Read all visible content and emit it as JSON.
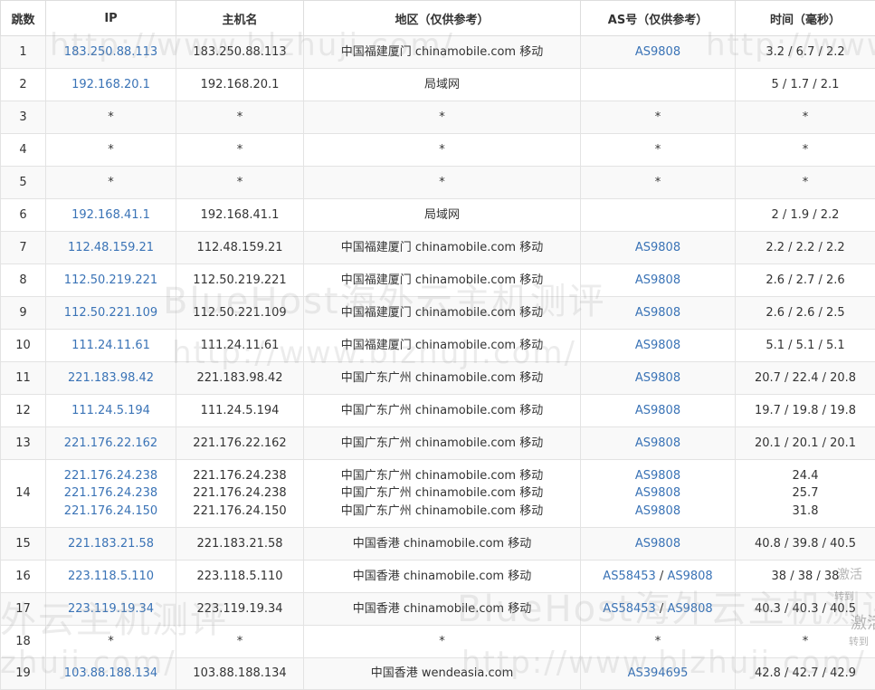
{
  "headers": {
    "hop": "跳数",
    "ip": "IP",
    "host": "主机名",
    "region": "地区（仅供参考）",
    "as": "AS号（仅供参考）",
    "time": "时间（毫秒）"
  },
  "rows": [
    {
      "hop": "1",
      "ips": [
        "183.250.88.113"
      ],
      "hosts": [
        "183.250.88.113"
      ],
      "regions": [
        "中国福建厦门 chinamobile.com 移动"
      ],
      "as": [
        [
          "AS9808"
        ]
      ],
      "times": [
        "3.2 / 6.7 / 2.2"
      ]
    },
    {
      "hop": "2",
      "ips": [
        "192.168.20.1"
      ],
      "hosts": [
        "192.168.20.1"
      ],
      "regions": [
        "局域网"
      ],
      "as": [],
      "times": [
        "5 / 1.7 / 2.1"
      ]
    },
    {
      "hop": "3",
      "ips": [
        "*"
      ],
      "hosts": [
        "*"
      ],
      "regions": [
        "*"
      ],
      "as": [
        [
          "*"
        ]
      ],
      "times": [
        "*"
      ]
    },
    {
      "hop": "4",
      "ips": [
        "*"
      ],
      "hosts": [
        "*"
      ],
      "regions": [
        "*"
      ],
      "as": [
        [
          "*"
        ]
      ],
      "times": [
        "*"
      ]
    },
    {
      "hop": "5",
      "ips": [
        "*"
      ],
      "hosts": [
        "*"
      ],
      "regions": [
        "*"
      ],
      "as": [
        [
          "*"
        ]
      ],
      "times": [
        "*"
      ]
    },
    {
      "hop": "6",
      "ips": [
        "192.168.41.1"
      ],
      "hosts": [
        "192.168.41.1"
      ],
      "regions": [
        "局域网"
      ],
      "as": [],
      "times": [
        "2 / 1.9 / 2.2"
      ]
    },
    {
      "hop": "7",
      "ips": [
        "112.48.159.21"
      ],
      "hosts": [
        "112.48.159.21"
      ],
      "regions": [
        "中国福建厦门 chinamobile.com 移动"
      ],
      "as": [
        [
          "AS9808"
        ]
      ],
      "times": [
        "2.2 / 2.2 / 2.2"
      ]
    },
    {
      "hop": "8",
      "ips": [
        "112.50.219.221"
      ],
      "hosts": [
        "112.50.219.221"
      ],
      "regions": [
        "中国福建厦门 chinamobile.com 移动"
      ],
      "as": [
        [
          "AS9808"
        ]
      ],
      "times": [
        "2.6 / 2.7 / 2.6"
      ]
    },
    {
      "hop": "9",
      "ips": [
        "112.50.221.109"
      ],
      "hosts": [
        "112.50.221.109"
      ],
      "regions": [
        "中国福建厦门 chinamobile.com 移动"
      ],
      "as": [
        [
          "AS9808"
        ]
      ],
      "times": [
        "2.6 / 2.6 / 2.5"
      ]
    },
    {
      "hop": "10",
      "ips": [
        "111.24.11.61"
      ],
      "hosts": [
        "111.24.11.61"
      ],
      "regions": [
        "中国福建厦门 chinamobile.com 移动"
      ],
      "as": [
        [
          "AS9808"
        ]
      ],
      "times": [
        "5.1 / 5.1 / 5.1"
      ]
    },
    {
      "hop": "11",
      "ips": [
        "221.183.98.42"
      ],
      "hosts": [
        "221.183.98.42"
      ],
      "regions": [
        "中国广东广州 chinamobile.com 移动"
      ],
      "as": [
        [
          "AS9808"
        ]
      ],
      "times": [
        "20.7 / 22.4 / 20.8"
      ]
    },
    {
      "hop": "12",
      "ips": [
        "111.24.5.194"
      ],
      "hosts": [
        "111.24.5.194"
      ],
      "regions": [
        "中国广东广州 chinamobile.com 移动"
      ],
      "as": [
        [
          "AS9808"
        ]
      ],
      "times": [
        "19.7 / 19.8 / 19.8"
      ]
    },
    {
      "hop": "13",
      "ips": [
        "221.176.22.162"
      ],
      "hosts": [
        "221.176.22.162"
      ],
      "regions": [
        "中国广东广州 chinamobile.com 移动"
      ],
      "as": [
        [
          "AS9808"
        ]
      ],
      "times": [
        "20.1 / 20.1 / 20.1"
      ]
    },
    {
      "hop": "14",
      "ips": [
        "221.176.24.238",
        "221.176.24.238",
        "221.176.24.150"
      ],
      "hosts": [
        "221.176.24.238",
        "221.176.24.238",
        "221.176.24.150"
      ],
      "regions": [
        "中国广东广州 chinamobile.com 移动",
        "中国广东广州 chinamobile.com 移动",
        "中国广东广州 chinamobile.com 移动"
      ],
      "as": [
        [
          "AS9808"
        ],
        [
          "AS9808"
        ],
        [
          "AS9808"
        ]
      ],
      "times": [
        "24.4",
        "25.7",
        "31.8"
      ]
    },
    {
      "hop": "15",
      "ips": [
        "221.183.21.58"
      ],
      "hosts": [
        "221.183.21.58"
      ],
      "regions": [
        "中国香港 chinamobile.com 移动"
      ],
      "as": [
        [
          "AS9808"
        ]
      ],
      "times": [
        "40.8 / 39.8 / 40.5"
      ]
    },
    {
      "hop": "16",
      "ips": [
        "223.118.5.110"
      ],
      "hosts": [
        "223.118.5.110"
      ],
      "regions": [
        "中国香港 chinamobile.com 移动"
      ],
      "as": [
        [
          "AS58453",
          "AS9808"
        ]
      ],
      "times": [
        "38 / 38 / 38"
      ]
    },
    {
      "hop": "17",
      "ips": [
        "223.119.19.34"
      ],
      "hosts": [
        "223.119.19.34"
      ],
      "regions": [
        "中国香港 chinamobile.com 移动"
      ],
      "as": [
        [
          "AS58453",
          "AS9808"
        ]
      ],
      "times": [
        "40.3 / 40.3 / 40.5"
      ]
    },
    {
      "hop": "18",
      "ips": [
        "*"
      ],
      "hosts": [
        "*"
      ],
      "regions": [
        "*"
      ],
      "as": [
        [
          "*"
        ]
      ],
      "times": [
        "*"
      ]
    },
    {
      "hop": "19",
      "ips": [
        "103.88.188.134"
      ],
      "hosts": [
        "103.88.188.134"
      ],
      "regions": [
        "中国香港 wendeasia.com"
      ],
      "as": [
        [
          "AS394695"
        ]
      ],
      "times": [
        "42.8 / 42.7 / 42.9"
      ]
    }
  ],
  "as_separator": " / ",
  "watermarks": {
    "brand": "BlueHost海外云主机测评",
    "url": "http://www.blzhuji.com/",
    "tail": "外云主机测评",
    "url_part": "zhuji.com/"
  },
  "overlay": {
    "activate": "激活",
    "goto": "转到"
  },
  "colors": {
    "link": "#3a73b6",
    "text": "#333333",
    "stripe": "#f9f9f9",
    "border": "#e3e3e3"
  }
}
